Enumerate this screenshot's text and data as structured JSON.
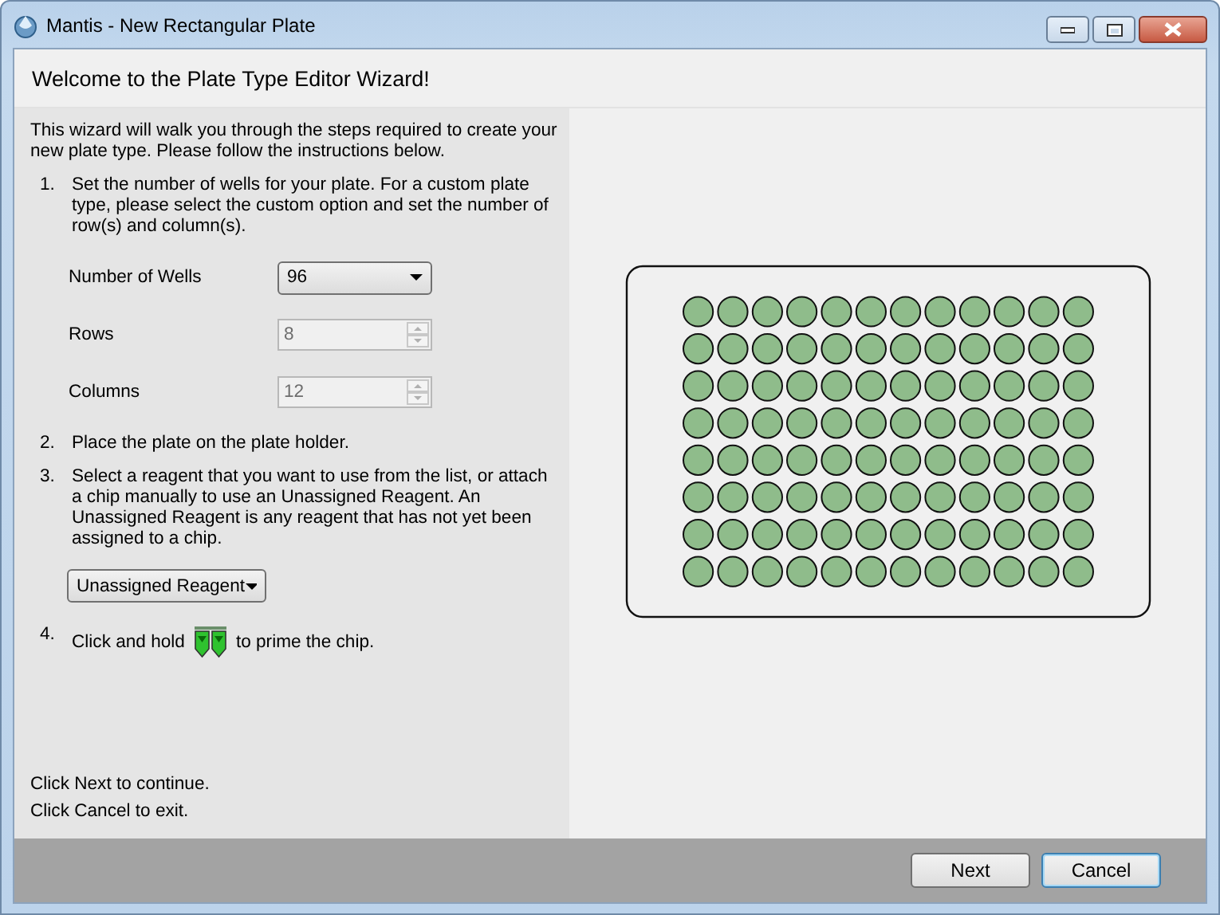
{
  "window": {
    "title": "Mantis - New Rectangular Plate"
  },
  "header": "Welcome to the Plate Type Editor Wizard!",
  "intro": "This wizard will walk you through the steps required to create your new plate type. Please follow the instructions below.",
  "steps": [
    {
      "number": "1.",
      "kind": "wells",
      "text": "Set the number of wells for your plate. For a custom plate type, please select the custom option and set the number of row(s) and column(s).",
      "fields": [
        {
          "label": "Number of Wells",
          "kind": "dropdown",
          "value": "96",
          "disabled": false
        },
        {
          "label": "Rows",
          "kind": "spinner",
          "value": "8",
          "disabled": true
        },
        {
          "label": "Columns",
          "kind": "spinner",
          "value": "12",
          "disabled": true
        }
      ]
    },
    {
      "number": "2.",
      "kind": "text",
      "text": "Place the plate on the plate holder."
    },
    {
      "number": "3.",
      "kind": "reagent",
      "text": "Select a reagent that you want to use from the list, or attach a chip manually to use an Unassigned Reagent. An Unassigned Reagent is any reagent that has not yet been assigned to a chip.",
      "value": "Unassigned Reagent"
    },
    {
      "number": "4.",
      "kind": "prime",
      "text_before": "Click and hold",
      "text_after": "to prime the chip."
    }
  ],
  "footer_lines": [
    "Click Next to continue.",
    "Click Cancel to exit."
  ],
  "buttons": [
    {
      "label": "Next",
      "focused": false
    },
    {
      "label": "Cancel",
      "focused": true
    }
  ]
}
